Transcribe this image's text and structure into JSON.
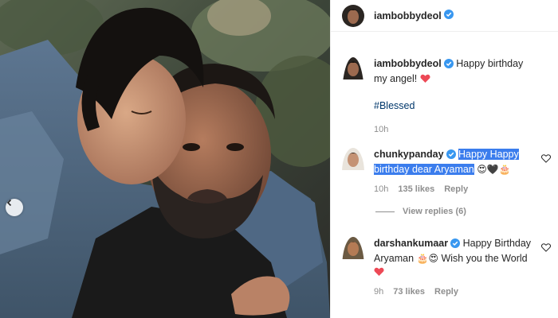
{
  "post": {
    "author": "iambobbydeol",
    "verified": true
  },
  "caption": {
    "username": "iambobbydeol",
    "text": "Happy birthday my angel!",
    "emoji": "❤️",
    "hashtag": "#Blessed",
    "time": "10h"
  },
  "comments": [
    {
      "username": "chunkypanday",
      "verified": true,
      "text_highlighted": "Happy Happy birthday dear Aryaman",
      "emoji": "😍🖤🎂",
      "time": "10h",
      "likes": "135 likes",
      "reply": "Reply"
    },
    {
      "username": "darshankumaar",
      "verified": true,
      "text_part1": "Happy Birthday Aryaman",
      "emoji1": "🎂😍",
      "text_part2": "Wish you the World",
      "emoji2": "❤️",
      "time": "9h",
      "likes": "73 likes",
      "reply": "Reply"
    }
  ],
  "view_replies": "View replies (6)",
  "icons": {
    "verified_badge": "verified-badge-icon",
    "like": "heart-outline-icon",
    "nav_prev": "chevron-left-icon"
  },
  "colors": {
    "verified": "#3897f0",
    "selection": "#3b7ded",
    "heart": "#ed4956",
    "muted": "#8e8e8e",
    "hashtag": "#00376b"
  }
}
